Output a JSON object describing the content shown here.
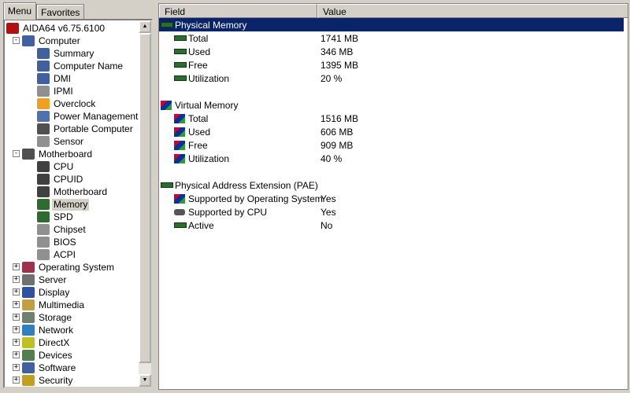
{
  "tabs": [
    "Menu",
    "Favorites"
  ],
  "tree": [
    {
      "label": "AIDA64 v6.75.6100",
      "level": 0,
      "icon": "aida64-logo-icon",
      "color": "#b01010"
    },
    {
      "label": "Computer",
      "level": 1,
      "icon": "computer-icon",
      "color": "#4060a0",
      "exp": "-"
    },
    {
      "label": "Summary",
      "level": 2,
      "icon": "computer-icon",
      "color": "#4060a0"
    },
    {
      "label": "Computer Name",
      "level": 2,
      "icon": "computer-icon",
      "color": "#4060a0"
    },
    {
      "label": "DMI",
      "level": 2,
      "icon": "computer-icon",
      "color": "#4060a0"
    },
    {
      "label": "IPMI",
      "level": 2,
      "icon": "ipmi-icon",
      "color": "#909090"
    },
    {
      "label": "Overclock",
      "level": 2,
      "icon": "flame-icon",
      "color": "#f0a020"
    },
    {
      "label": "Power Management",
      "level": 2,
      "icon": "power-icon",
      "color": "#5070b0"
    },
    {
      "label": "Portable Computer",
      "level": 2,
      "icon": "laptop-icon",
      "color": "#505050"
    },
    {
      "label": "Sensor",
      "level": 2,
      "icon": "sensor-icon",
      "color": "#909090"
    },
    {
      "label": "Motherboard",
      "level": 1,
      "icon": "motherboard-icon",
      "color": "#505050",
      "exp": "-"
    },
    {
      "label": "CPU",
      "level": 2,
      "icon": "cpu-icon",
      "color": "#404040"
    },
    {
      "label": "CPUID",
      "level": 2,
      "icon": "cpu-icon",
      "color": "#404040"
    },
    {
      "label": "Motherboard",
      "level": 2,
      "icon": "motherboard-icon",
      "color": "#404040"
    },
    {
      "label": "Memory",
      "level": 2,
      "icon": "memory-icon",
      "color": "#2f6b2f",
      "selected": true
    },
    {
      "label": "SPD",
      "level": 2,
      "icon": "memory-icon",
      "color": "#2f6b2f"
    },
    {
      "label": "Chipset",
      "level": 2,
      "icon": "chipset-icon",
      "color": "#909090"
    },
    {
      "label": "BIOS",
      "level": 2,
      "icon": "bios-icon",
      "color": "#909090"
    },
    {
      "label": "ACPI",
      "level": 2,
      "icon": "acpi-icon",
      "color": "#909090"
    },
    {
      "label": "Operating System",
      "level": 1,
      "icon": "windows-icon",
      "color": "#a03050",
      "exp": "+"
    },
    {
      "label": "Server",
      "level": 1,
      "icon": "server-icon",
      "color": "#707070",
      "exp": "+"
    },
    {
      "label": "Display",
      "level": 1,
      "icon": "display-icon",
      "color": "#3050a0",
      "exp": "+"
    },
    {
      "label": "Multimedia",
      "level": 1,
      "icon": "speaker-icon",
      "color": "#c0a040",
      "exp": "+"
    },
    {
      "label": "Storage",
      "level": 1,
      "icon": "storage-icon",
      "color": "#708070",
      "exp": "+"
    },
    {
      "label": "Network",
      "level": 1,
      "icon": "globe-icon",
      "color": "#3080c0",
      "exp": "+"
    },
    {
      "label": "DirectX",
      "level": 1,
      "icon": "directx-icon",
      "color": "#c0c020",
      "exp": "+"
    },
    {
      "label": "Devices",
      "level": 1,
      "icon": "devices-icon",
      "color": "#508050",
      "exp": "+"
    },
    {
      "label": "Software",
      "level": 1,
      "icon": "software-icon",
      "color": "#4060a0",
      "exp": "+"
    },
    {
      "label": "Security",
      "level": 1,
      "icon": "shield-icon",
      "color": "#c0a020",
      "exp": "+"
    }
  ],
  "columns": {
    "field": "Field",
    "value": "Value"
  },
  "rows": [
    {
      "field": "Physical Memory",
      "level": 0,
      "icon": "ram",
      "selected": true
    },
    {
      "field": "Total",
      "value": "1741 MB",
      "level": 1,
      "icon": "ram"
    },
    {
      "field": "Used",
      "value": "346 MB",
      "level": 1,
      "icon": "ram"
    },
    {
      "field": "Free",
      "value": "1395 MB",
      "level": 1,
      "icon": "ram"
    },
    {
      "field": "Utilization",
      "value": "20 %",
      "level": 1,
      "icon": "ram"
    },
    null,
    {
      "field": "Virtual Memory",
      "level": 0,
      "icon": "vm"
    },
    {
      "field": "Total",
      "value": "1516 MB",
      "level": 1,
      "icon": "vm"
    },
    {
      "field": "Used",
      "value": "606 MB",
      "level": 1,
      "icon": "vm"
    },
    {
      "field": "Free",
      "value": "909 MB",
      "level": 1,
      "icon": "vm"
    },
    {
      "field": "Utilization",
      "value": "40 %",
      "level": 1,
      "icon": "vm"
    },
    null,
    {
      "field": "Physical Address Extension (PAE)",
      "level": 0,
      "icon": "ram"
    },
    {
      "field": "Supported by Operating System",
      "value": "Yes",
      "level": 1,
      "icon": "vm"
    },
    {
      "field": "Supported by CPU",
      "value": "Yes",
      "level": 1,
      "icon": "chip"
    },
    {
      "field": "Active",
      "value": "No",
      "level": 1,
      "icon": "ram"
    }
  ]
}
